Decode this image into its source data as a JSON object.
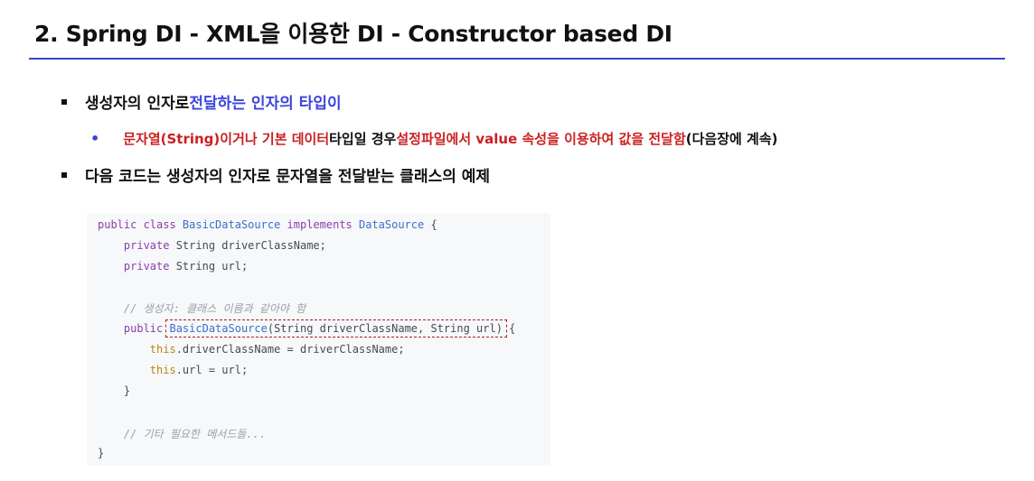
{
  "slide": {
    "title": "2. Spring DI - XML을 이용한 DI - Constructor based DI"
  },
  "bullets": {
    "first_plain": "생성자의 인자로 ",
    "first_highlight": "전달하는 인자의 타입이",
    "sub_part1": "문자열(String)이거나 기본 데이터",
    "sub_part2": " 타입일 경우 ",
    "sub_part3": "설정파일에서 value 속성을 이용하여 값을 전달함",
    "sub_part4": " (다음장에 계속)",
    "second": "다음 코드는 생성자의 인자로 문자열을 전달받는 클래스의 예제"
  },
  "code": {
    "l1_kw": "public class ",
    "l1_type": "BasicDataSource",
    "l1_kw2": " implements ",
    "l1_type2": "DataSource",
    "l1_rest": " {",
    "l2_kw": "    private ",
    "l2_rest": "String driverClassName;",
    "l3_kw": "    private ",
    "l3_rest": "String url;",
    "l5_comment": "    // 생성자: 클래스 이름과 같아야 함",
    "l6_kw": "    public ",
    "l6_type": "BasicDataSource",
    "l6_rest": "(String driverClassName, String url) {",
    "l7_this": "        this",
    "l7_rest": ".driverClassName = driverClassName;",
    "l8_this": "        this",
    "l8_rest": ".url = url;",
    "l9": "    }",
    "l11_comment": "    // 기타 필요한 메서드들...",
    "l12": "}"
  },
  "colors": {
    "accent_blue": "#3a45e0",
    "accent_red": "#cc1f1f",
    "rule": "#3a45c8"
  }
}
